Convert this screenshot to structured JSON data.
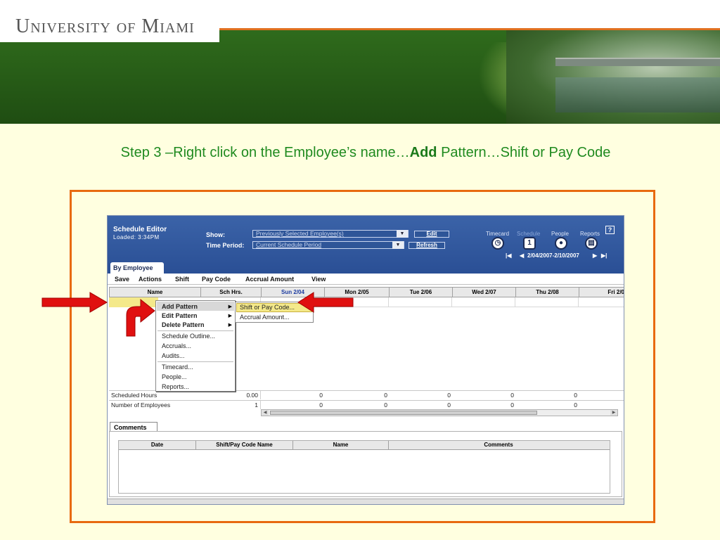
{
  "banner": {
    "logo": "University of Miami"
  },
  "slide": {
    "title_pre": "Step 3 –Right click on the Employee’s name…",
    "title_bold": "Add",
    "title_post": " Pattern…Shift or Pay Code"
  },
  "app": {
    "title": "Schedule Editor",
    "loaded": "Loaded: 3:34PM",
    "show_label": "Show:",
    "show_value": "Previously Selected Employee(s)",
    "edit_button": "Edit",
    "period_label": "Time Period:",
    "period_value": "Current Schedule Period",
    "refresh_button": "Refresh",
    "nav": {
      "timecard": "Timecard",
      "schedule": "Schedule",
      "people": "People",
      "reports": "Reports"
    },
    "help": "?",
    "date_range": "2/04/2007-2/10/2007",
    "tab": "By Employee",
    "toolbar": [
      "Save",
      "Actions",
      "Shift",
      "Pay Code",
      "Accrual Amount",
      "View"
    ],
    "columns": [
      "Name",
      "Sch Hrs.",
      "Sun 2/04",
      "Mon 2/05",
      "Tue 2/06",
      "Wed 2/07",
      "Thu 2/08",
      "Fri 2/0"
    ],
    "summary": [
      {
        "label": "Scheduled Hours",
        "values": [
          "0.00",
          "0",
          "0",
          "0",
          "0",
          "0"
        ]
      },
      {
        "label": "Number of Employees",
        "values": [
          "1",
          "0",
          "0",
          "0",
          "0",
          "0"
        ]
      }
    ],
    "context_menu": {
      "add_pattern": "Add Pattern",
      "edit_pattern": "Edit Pattern",
      "delete_pattern": "Delete Pattern",
      "schedule_outline": "Schedule Outline...",
      "accruals": "Accruals...",
      "audits": "Audits...",
      "timecard": "Timecard...",
      "people": "People...",
      "reports": "Reports..."
    },
    "submenu": {
      "shift": "Shift or Pay Code...",
      "accrual": "Accrual Amount..."
    },
    "comments_tab": "Comments",
    "comments_columns": [
      "Date",
      "Shift/Pay Code Name",
      "Name",
      "Comments"
    ]
  },
  "colors": {
    "accent": "#1f8a1f",
    "frame": "#e86a10",
    "arrow": "#e01010",
    "header": "#2a4f95"
  }
}
